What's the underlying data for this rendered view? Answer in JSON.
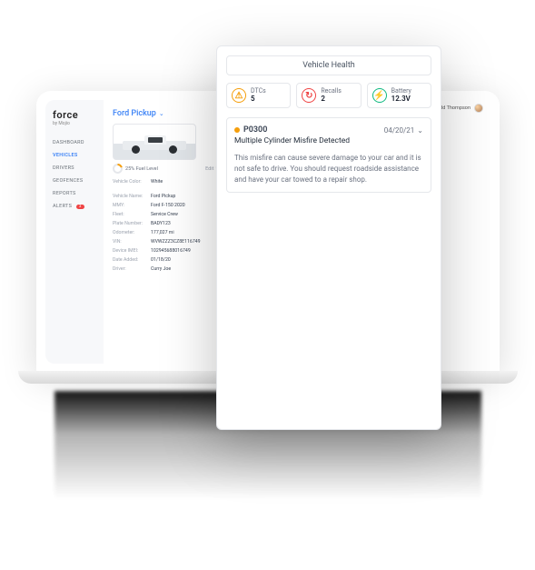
{
  "brand": {
    "name": "force",
    "byline": "by Mojio"
  },
  "user": {
    "name": "Todd Thompson"
  },
  "nav": {
    "items": [
      {
        "label": "DASHBOARD"
      },
      {
        "label": "VEHICLES",
        "active": true
      },
      {
        "label": "DRIVERS"
      },
      {
        "label": "GEOFENCES"
      },
      {
        "label": "REPORTS"
      },
      {
        "label": "ALERTS",
        "badge": "3"
      }
    ]
  },
  "vehicle": {
    "title": "Ford Pickup",
    "fuel_label": "25% Fuel Level",
    "edit_label": "Edit",
    "color_label": "Vehicle Color:",
    "color_value": "White",
    "specs": [
      {
        "label": "Vehicle Name:",
        "value": "Ford Pickup"
      },
      {
        "label": "MMY:",
        "value": "Ford F-150 2020"
      },
      {
        "label": "Fleet:",
        "value": "Service Crew"
      },
      {
        "label": "Plate Number:",
        "value": "BADY123"
      },
      {
        "label": "Odometer:",
        "value": "177,027 mi"
      },
      {
        "label": "VIN:",
        "value": "WVWZZZ3CZ8E116749"
      },
      {
        "label": "Device IMEI:",
        "value": "102945688016749"
      },
      {
        "label": "Date Added:",
        "value": "01/18/20"
      },
      {
        "label": "Driver:",
        "value": "Curry Joe"
      }
    ]
  },
  "modal": {
    "title": "Vehicle Health",
    "stats": {
      "dtc": {
        "label": "DTCs",
        "value": "5"
      },
      "recall": {
        "label": "Recalls",
        "value": "2"
      },
      "batt": {
        "label": "Battery",
        "value": "12.3V"
      }
    },
    "dtc": {
      "code": "P0300",
      "date": "04/20/21",
      "title": "Multiple Cylinder Misfire Detected",
      "body": "This misfire can cause severe damage to your car and it is not safe to drive. You should request roadside assistance and have your car towed to a repair shop."
    }
  }
}
